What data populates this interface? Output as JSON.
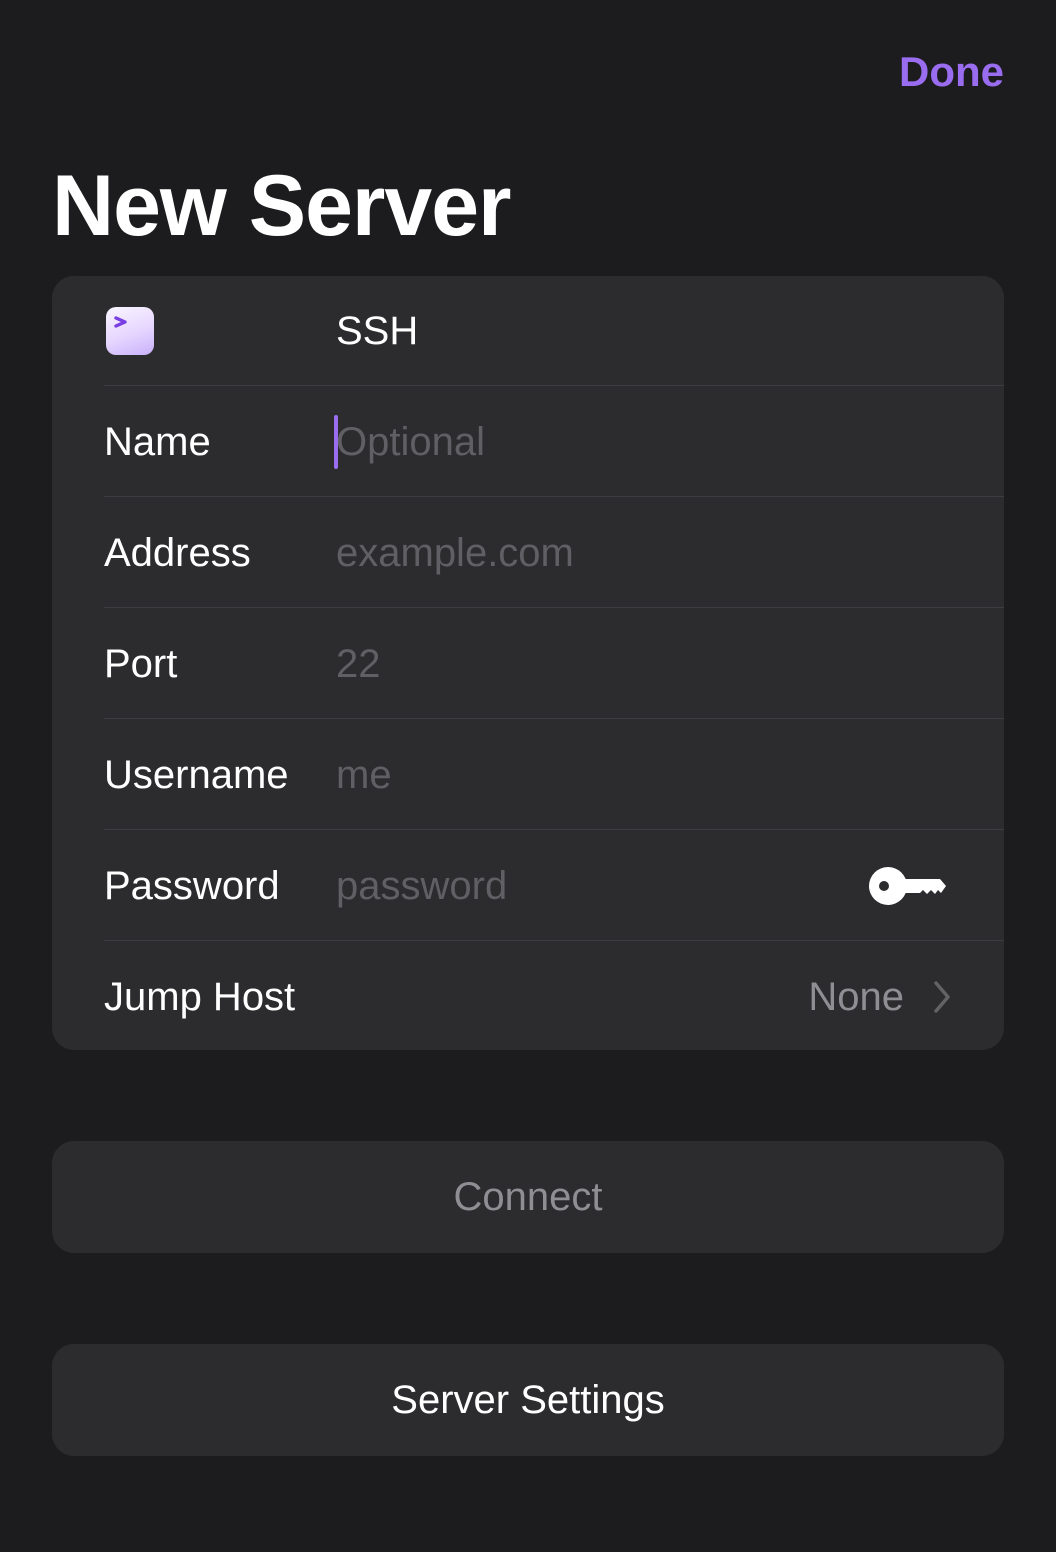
{
  "header": {
    "done_label": "Done",
    "title": "New Server"
  },
  "colors": {
    "accent": "#9a6cf0",
    "background": "#1c1c1e",
    "card": "#2c2c2e",
    "placeholder": "#5f5f64",
    "secondary_text": "#8e8e93"
  },
  "form": {
    "protocol": {
      "icon": "terminal-app-icon",
      "label": "SSH"
    },
    "name": {
      "label": "Name",
      "value": "",
      "placeholder": "Optional"
    },
    "address": {
      "label": "Address",
      "value": "",
      "placeholder": "example.com"
    },
    "port": {
      "label": "Port",
      "value": "",
      "placeholder": "22"
    },
    "username": {
      "label": "Username",
      "value": "",
      "placeholder": "me"
    },
    "password": {
      "label": "Password",
      "value": "",
      "placeholder": "password",
      "icon": "key-icon"
    },
    "jump_host": {
      "label": "Jump Host",
      "value": "None",
      "icon": "chevron-right-icon"
    }
  },
  "actions": {
    "connect_label": "Connect",
    "server_settings_label": "Server Settings"
  }
}
